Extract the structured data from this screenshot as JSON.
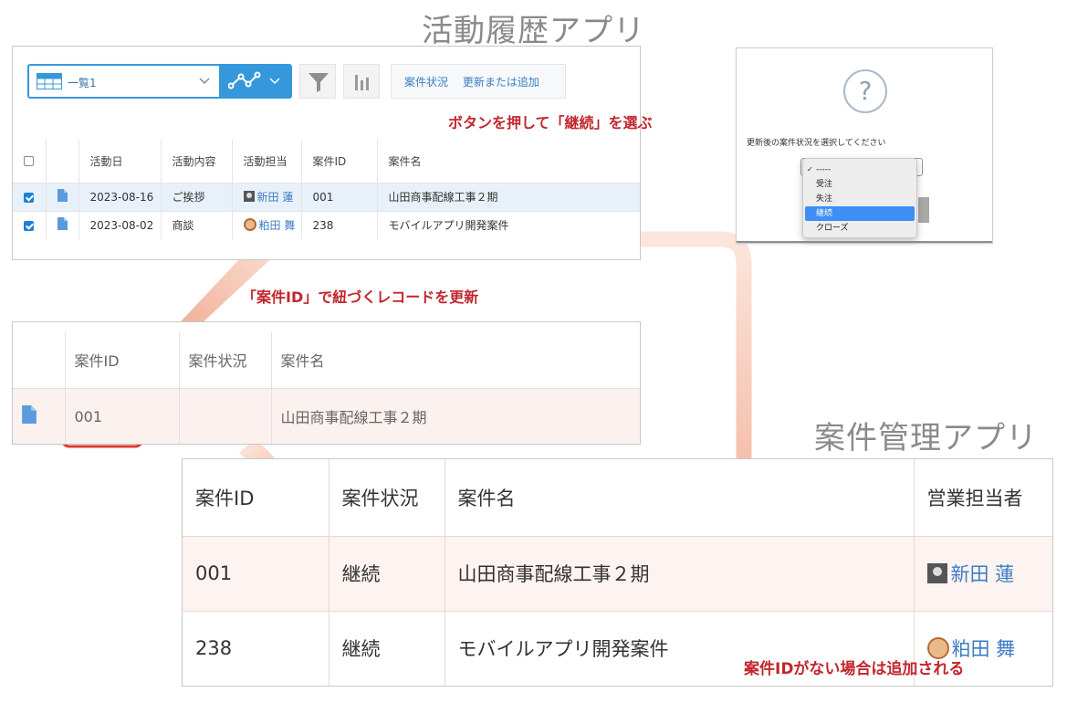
{
  "titles": {
    "activity_app": "活動履歴アプリ",
    "case_app": "案件管理アプリ"
  },
  "activity": {
    "view_label": "一覧1",
    "action_buttons": [
      "案件状況",
      "更新または追加"
    ],
    "columns": [
      "活動日",
      "活動内容",
      "活動担当",
      "案件ID",
      "案件名"
    ],
    "rows": [
      {
        "checked": true,
        "date": "2023-08-16",
        "content": "ご挨拶",
        "owner": "新田 蓮",
        "case_id": "001",
        "case_name": "山田商事配線工事２期"
      },
      {
        "checked": true,
        "date": "2023-08-02",
        "content": "商談",
        "owner": "粕田 舞",
        "case_id": "238",
        "case_name": "モバイルアプリ開発案件"
      }
    ]
  },
  "modal": {
    "prompt": "更新後の案件状況を選択してください",
    "options": [
      "-----",
      "受注",
      "失注",
      "継続",
      "クローズ"
    ],
    "selected_index": 3
  },
  "annotations": {
    "pick_continue": "ボタンを押して「継続」を選ぶ",
    "update_linked": "「案件ID」で紐づくレコードを更新",
    "added_if_missing": "案件IDがない場合は追加される"
  },
  "mid_table": {
    "columns": [
      "案件ID",
      "案件状況",
      "案件名"
    ],
    "rows": [
      {
        "case_id": "001",
        "status": "",
        "case_name": "山田商事配線工事２期"
      }
    ]
  },
  "case_table": {
    "columns": [
      "案件ID",
      "案件状況",
      "案件名",
      "営業担当者"
    ],
    "rows": [
      {
        "case_id": "001",
        "status": "継続",
        "case_name": "山田商事配線工事２期",
        "owner": "新田 蓮"
      },
      {
        "case_id": "238",
        "status": "継続",
        "case_name": "モバイルアプリ開発案件",
        "owner": "粕田 舞"
      }
    ]
  },
  "colors": {
    "accent_blue": "#3498db",
    "link_blue": "#3b7dc4",
    "annotation_red": "#c1272d",
    "highlight_red": "#e03a2f",
    "arrow_salmon": "#f0a58a"
  }
}
